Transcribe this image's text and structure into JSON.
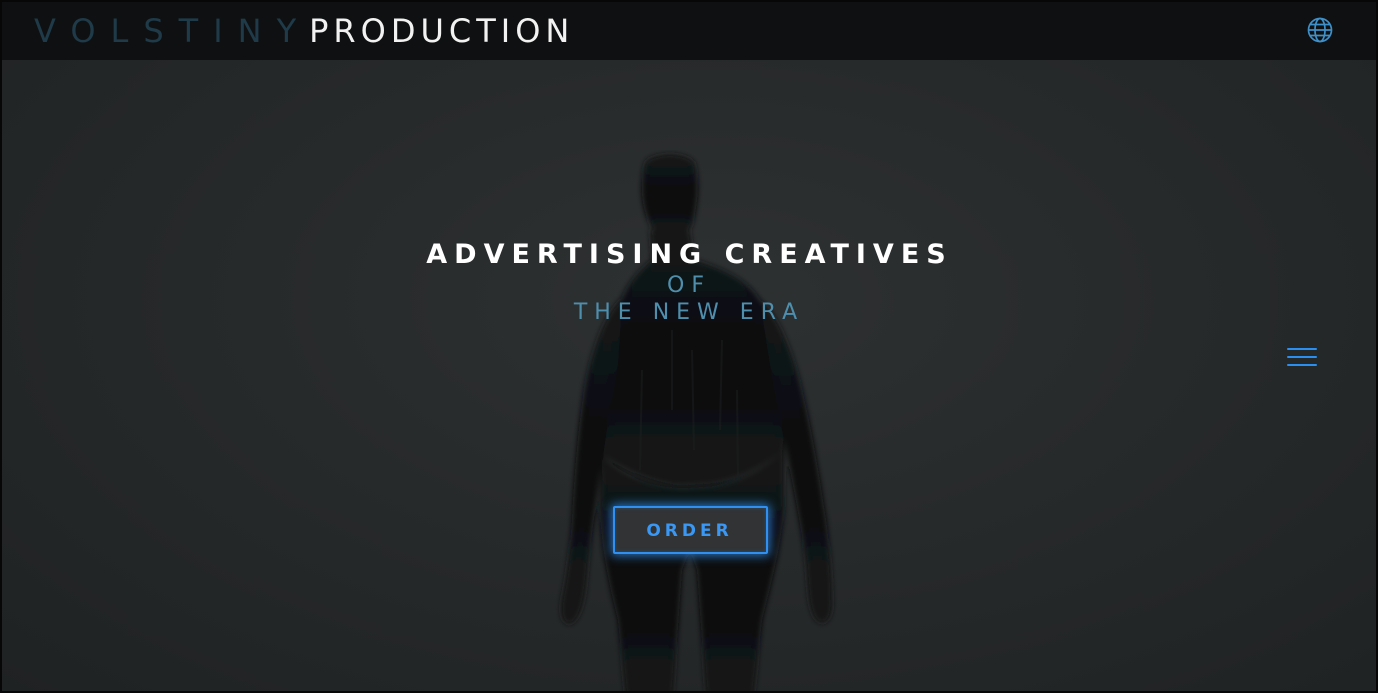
{
  "header": {
    "logo_part1": "VOLSTINY",
    "logo_part2": "PRODUCTION",
    "language_icon": "globe-icon"
  },
  "hero": {
    "headline": "ADVERTISING CREATIVES",
    "subline_1": "OF",
    "subline_2": "THE NEW ERA",
    "order_label": "ORDER",
    "menu_icon": "hamburger-menu-icon",
    "background_image": "dark-silhouette-figure"
  },
  "colors": {
    "header_bg": "#0f1011",
    "hero_bg": "#2a2d2e",
    "logo_dim": "#1f3a48",
    "logo_bright": "#f2f2f2",
    "accent_blue": "#2f90f2",
    "subline_blue": "#4f8fae"
  }
}
